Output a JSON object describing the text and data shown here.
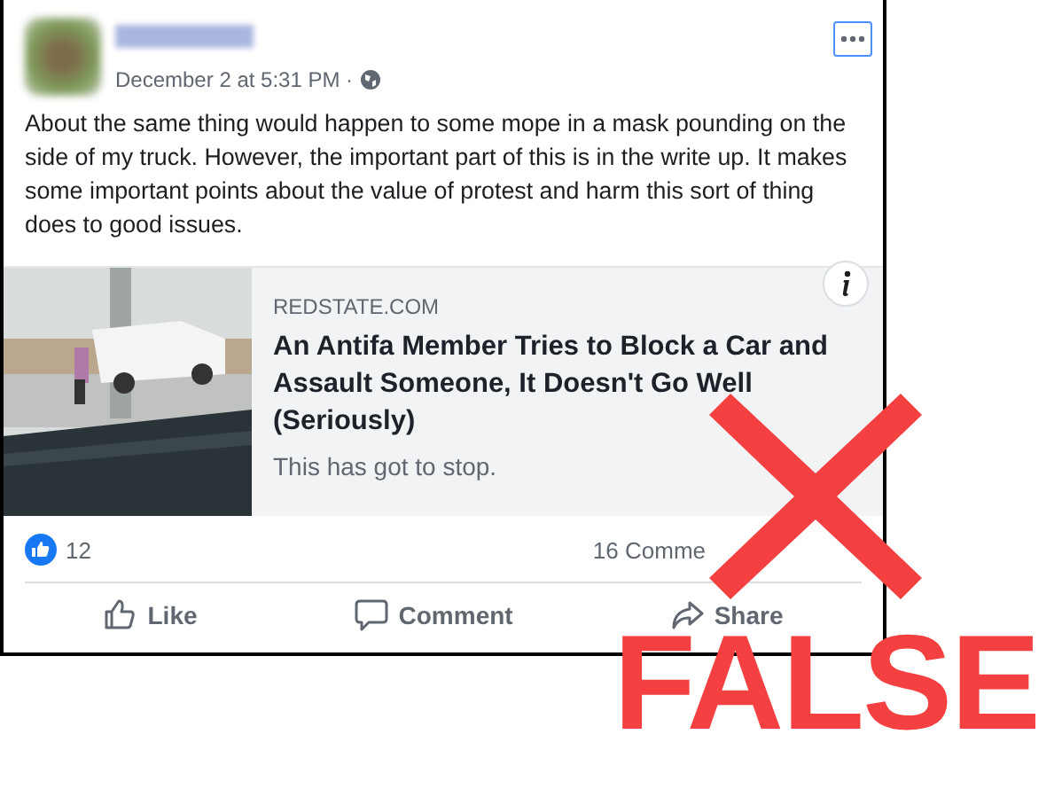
{
  "post": {
    "timestamp": "December 2 at 5:31 PM ·",
    "text": "About the same thing would happen to some mope in a mask pounding on the side of my truck. However, the important part of this is in the write up. It makes some important points about the value of protest and harm this sort of thing does to good issues.",
    "link": {
      "kind": "picture",
      "source": "REDSTATE.COM",
      "title": "An Antifa Member Tries to Block a Car and Assault Someone, It Doesn't Go Well (Seriously)",
      "description": "This has got to stop."
    },
    "likes": "12",
    "comments": "16 Comme",
    "actions": [
      {
        "kind": "like",
        "label": "Like"
      },
      {
        "kind": "comment",
        "label": "Comment"
      },
      {
        "kind": "share",
        "label": "Share"
      }
    ]
  },
  "verdict": {
    "label": "FALSE"
  }
}
